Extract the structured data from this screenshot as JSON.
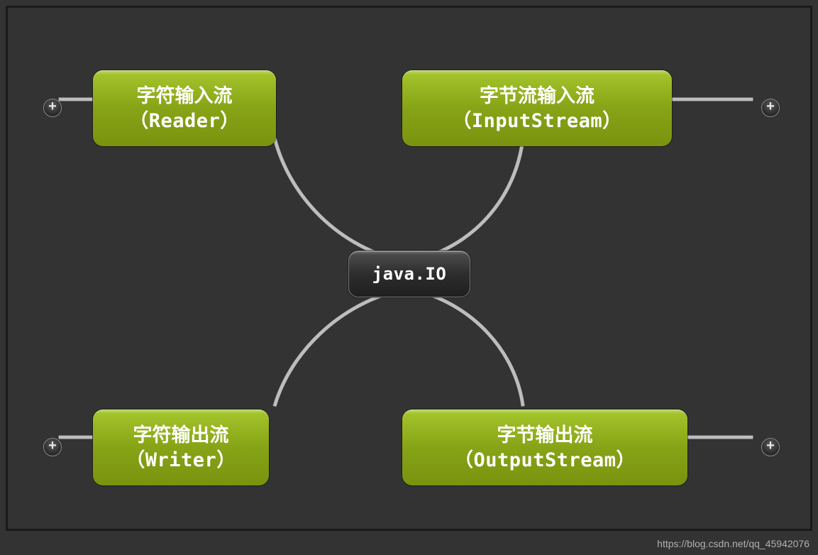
{
  "center": {
    "label": "java.IO"
  },
  "nodes": {
    "topLeft": {
      "title": "字符输入流",
      "subtitle": "（Reader）"
    },
    "topRight": {
      "title": "字节流输入流",
      "subtitle": "（InputStream）"
    },
    "bottomLeft": {
      "title": "字符输出流",
      "subtitle": "（Writer）"
    },
    "bottomRight": {
      "title": "字节输出流",
      "subtitle": "（OutputStream）"
    }
  },
  "watermark": "https://blog.csdn.net/qq_45942076",
  "colors": {
    "nodeGreen": "#87a316",
    "background": "#333333"
  }
}
